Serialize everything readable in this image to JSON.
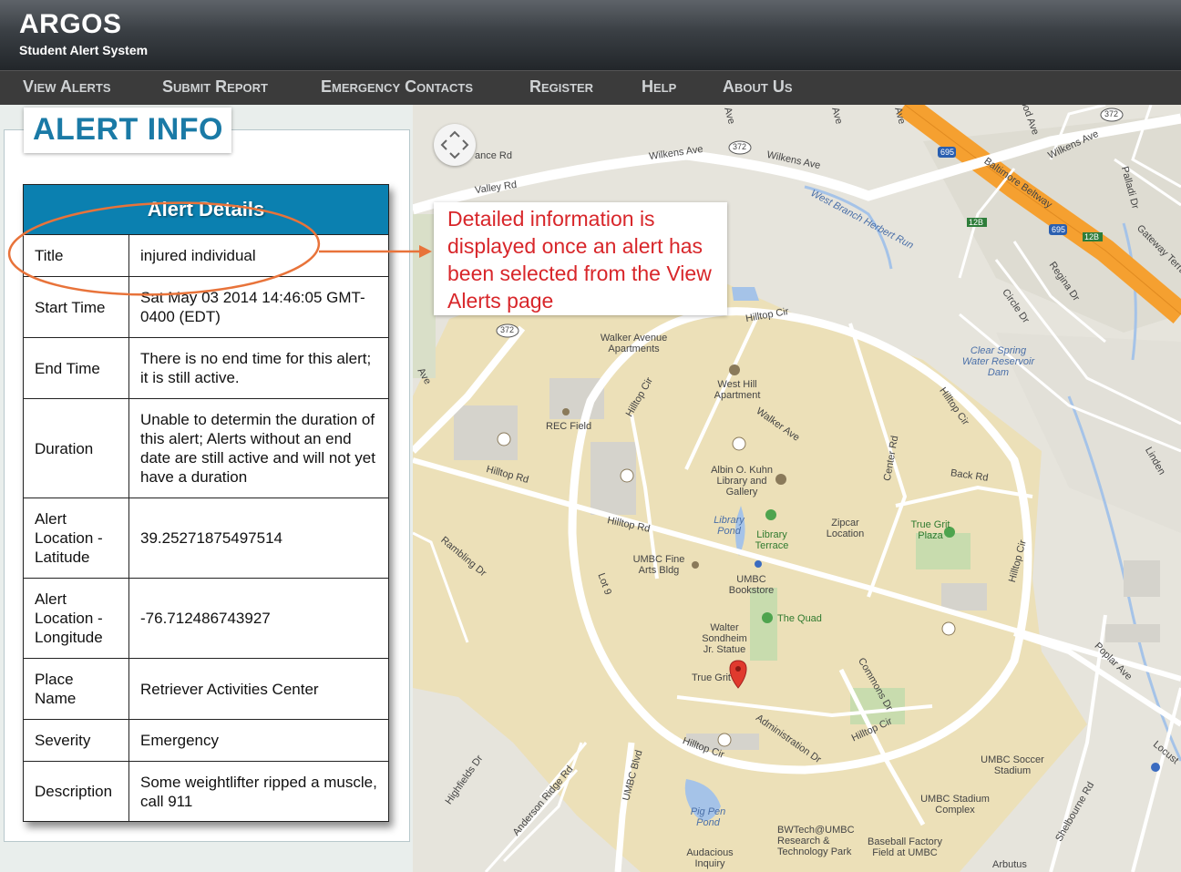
{
  "header": {
    "title": "ARGOS",
    "subtitle": "Student Alert System"
  },
  "nav": {
    "items": [
      {
        "label": "View Alerts"
      },
      {
        "label": "Submit Report"
      },
      {
        "label": "Emergency Contacts"
      },
      {
        "label": "Register"
      },
      {
        "label": "Help"
      },
      {
        "label": "About Us"
      }
    ]
  },
  "panel": {
    "title": "ALERT INFO",
    "table_header": "Alert Details",
    "rows": [
      {
        "label": "Title",
        "value": "injured individual"
      },
      {
        "label": "Start Time",
        "value": "Sat May 03 2014 14:46:05 GMT-0400 (EDT)"
      },
      {
        "label": "End Time",
        "value": "There is no end time for this alert; it is still active."
      },
      {
        "label": "Duration",
        "value": "Unable to determin the duration of this alert; Alerts without an end date are still active and will not yet have a duration"
      },
      {
        "label": "Alert Location - Latitude",
        "value": "39.25271875497514"
      },
      {
        "label": "Alert Location - Longitude",
        "value": "-76.712486743927"
      },
      {
        "label": "Place Name",
        "value": "Retriever Activities Center"
      },
      {
        "label": "Severity",
        "value": "Emergency"
      },
      {
        "label": "Description",
        "value": "Some weightlifter ripped a muscle, call 911"
      }
    ]
  },
  "callout": {
    "text": "Detailed information is displayed once an alert has been selected from the View Alerts page"
  },
  "map": {
    "labels": {
      "wilkens_ave_1": "Wilkens Ave",
      "wilkens_ave_2": "Wilkens Ave",
      "wilkens_ave_3": "Wilkens Ave",
      "valley_rd": "Valley Rd",
      "ance_rd": "ance Rd",
      "baltimore_beltway": "Baltimore Beltway",
      "west_branch": "West Branch Herbert Run",
      "hilltop_cir_1": "Hilltop Cir",
      "hilltop_cir_2": "Hilltop Cir",
      "hilltop_cir_3": "Hilltop Cir",
      "hilltop_cir_4": "Hilltop Cir",
      "hilltop_cir_5": "Hilltop Cir",
      "hilltop_cir_6": "Hilltop Cir",
      "hilltop_rd_1": "Hilltop Rd",
      "hilltop_rd_2": "Hilltop Rd",
      "walker_ave": "Walker Ave",
      "walker_apts": "Walker Avenue Apartments",
      "west_hill": "West Hill Apartment",
      "rec_field": "REC Field",
      "kuhn_library": "Albin O. Kuhn Library and Gallery",
      "library_pond": "Library Pond",
      "library_terrace": "Library Terrace",
      "zipcar": "Zipcar Location",
      "true_grit_plaza": "True Grit Plaza",
      "center_rd": "Center Rd",
      "back_rd": "Back Rd",
      "fine_arts": "UMBC Fine Arts Bldg",
      "bookstore": "UMBC Bookstore",
      "the_quad": "The Quad",
      "sondheim": "Walter Sondheim Jr. Statue",
      "true_grit": "True Grit",
      "administration_dr": "Administration Dr",
      "commons_dr": "Commons Dr",
      "clear_spring": "Clear Spring Water Reservoir Dam",
      "regina_dr": "Regina Dr",
      "circle_dr": "Circle Dr",
      "poplar_ave": "Poplar Ave",
      "rambling_dr": "Rambling Dr",
      "lot9": "Lot 9",
      "highfields_dr": "Highfields Dr",
      "anderson_ridge": "Anderson Ridge Rd",
      "umbc_blvd": "UMBC Blvd",
      "pig_pen_pond": "Pig Pen Pond",
      "bwtech": "BWTech@UMBC Research & Technology Park",
      "baseball": "Baseball Factory Field at UMBC",
      "soccer": "UMBC Soccer Stadium",
      "stadium_complex": "UMBC Stadium Complex",
      "shelbourne_rd": "Shelbourne Rd",
      "arbutus": "Arbutus",
      "audacious": "Audacious Inquiry",
      "gateway_terrace": "Gateway Terrac",
      "palladi_dr": "Palladi Dr",
      "linden": "Linden",
      "locust": "Locust",
      "rt372_1": "372",
      "rt372_2": "372",
      "rt372_3": "372",
      "i695_1": "695",
      "i695_2": "695",
      "exit_12b_1": "12B",
      "exit_12b_2": "12B",
      "ood_ave": "ood Ave",
      "ave_1": "Ave",
      "ave_2": "Ave",
      "ave_3": "Ave",
      "ave_4": "Ave"
    },
    "colors": {
      "campus": "#ece0b8",
      "road": "#ffffff",
      "highway": "#f5a030",
      "water": "#a5c3e8",
      "park": "#c8dcae",
      "building": "#d5d3cc"
    }
  }
}
